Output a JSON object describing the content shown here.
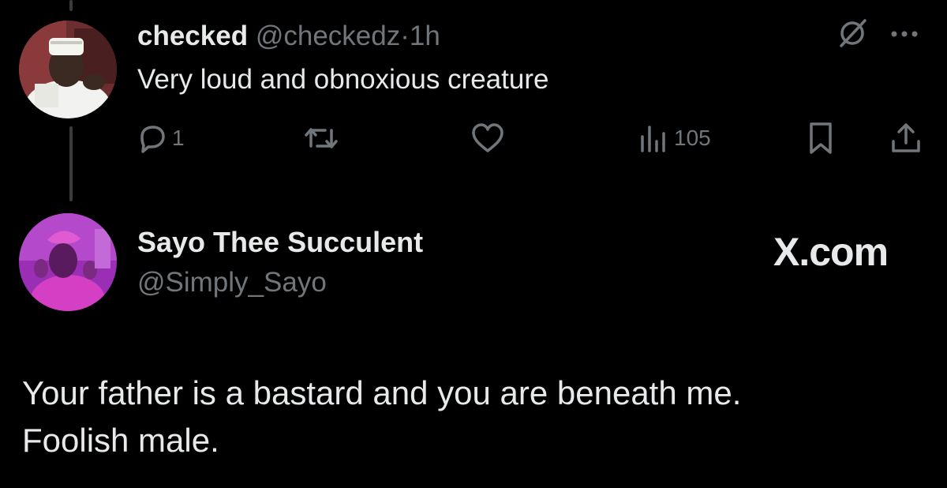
{
  "reply": {
    "author_name": "checked",
    "author_handle": "@checkedz",
    "separator": "·",
    "time": "1h",
    "text": "Very loud and obnoxious creature",
    "reply_count": "1",
    "retweet_count": "",
    "like_count": "",
    "view_count": "105",
    "avatar_icon": "avatar-photo-man-in-white-cap",
    "top_icons": [
      "grok-icon",
      "more-icon"
    ]
  },
  "quoted": {
    "author_name": "Sayo Thee Succulent",
    "author_handle": "@Simply_Sayo",
    "brand": "X.com",
    "avatar_icon": "avatar-photo-woman-pink-tint",
    "text_lines": [
      "Your father is a bastard and you are beneath me.",
      "Foolish male."
    ]
  },
  "colors": {
    "background": "#000000",
    "primary_text": "#e7e9ea",
    "secondary_text": "#71767b",
    "thread_line": "#3a3b3d"
  }
}
